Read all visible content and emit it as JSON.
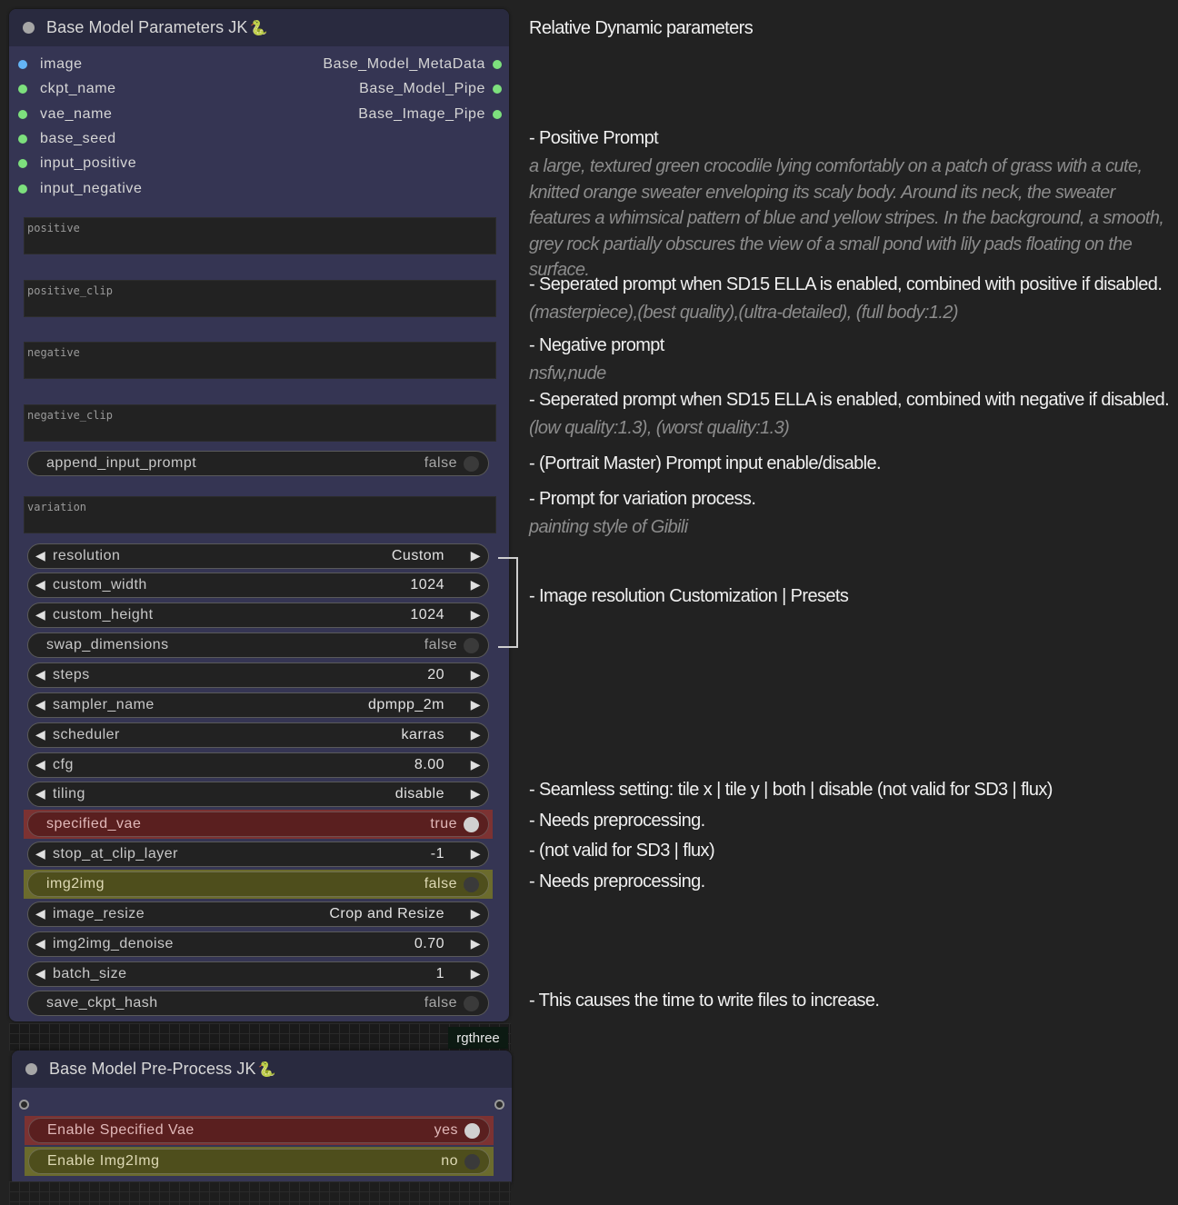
{
  "node_params": {
    "title": "Base Model Parameters JK",
    "title_icon": "🐍",
    "inputs": [
      "image",
      "ckpt_name",
      "vae_name",
      "base_seed",
      "input_positive",
      "input_negative"
    ],
    "outputs": [
      "Base_Model_MetaData",
      "Base_Model_Pipe",
      "Base_Image_Pipe"
    ],
    "textboxes": {
      "positive": "positive",
      "positive_clip": "positive_clip",
      "negative": "negative",
      "negative_clip": "negative_clip",
      "variation": "variation"
    },
    "append_input_prompt": {
      "label": "append_input_prompt",
      "value": "false"
    },
    "widgets": {
      "resolution": {
        "label": "resolution",
        "value": "Custom"
      },
      "custom_width": {
        "label": "custom_width",
        "value": "1024"
      },
      "custom_height": {
        "label": "custom_height",
        "value": "1024"
      },
      "swap_dimensions": {
        "label": "swap_dimensions",
        "value": "false"
      },
      "steps": {
        "label": "steps",
        "value": "20"
      },
      "sampler_name": {
        "label": "sampler_name",
        "value": "dpmpp_2m"
      },
      "scheduler": {
        "label": "scheduler",
        "value": "karras"
      },
      "cfg": {
        "label": "cfg",
        "value": "8.00"
      },
      "tiling": {
        "label": "tiling",
        "value": "disable"
      },
      "specified_vae": {
        "label": "specified_vae",
        "value": "true"
      },
      "stop_at_clip_layer": {
        "label": "stop_at_clip_layer",
        "value": "-1"
      },
      "img2img": {
        "label": "img2img",
        "value": "false"
      },
      "image_resize": {
        "label": "image_resize",
        "value": "Crop and Resize"
      },
      "img2img_denoise": {
        "label": "img2img_denoise",
        "value": "0.70"
      },
      "batch_size": {
        "label": "batch_size",
        "value": "1"
      },
      "save_ckpt_hash": {
        "label": "save_ckpt_hash",
        "value": "false"
      }
    }
  },
  "rgthree_label": "rgthree",
  "node_preprocess": {
    "title": "Base Model Pre-Process JK",
    "title_icon": "🐍",
    "enable_vae": {
      "label": "Enable Specified Vae",
      "value": "yes"
    },
    "enable_img2img": {
      "label": "Enable Img2Img",
      "value": "no"
    }
  },
  "notes": {
    "heading": "Relative Dynamic parameters",
    "positive_title": "- Positive Prompt",
    "positive_example": "a large, textured green crocodile lying comfortably on a patch of grass with a cute, knitted orange sweater enveloping its scaly body. Around its neck, the sweater features a whimsical pattern of blue and yellow stripes. In the background, a smooth, grey rock partially obscures the view of a small pond with lily pads floating on the surface.",
    "positive_clip_title": "- Seperated prompt when SD15 ELLA is enabled, combined with positive if disabled.",
    "positive_clip_example": "(masterpiece),(best quality),(ultra-detailed), (full body:1.2)",
    "negative_title": "- Negative prompt",
    "negative_example": "nsfw,nude",
    "negative_clip_title": "- Seperated prompt when SD15 ELLA is enabled, combined with negative if disabled.",
    "negative_clip_example": "(low quality:1.3), (worst quality:1.3)",
    "portrait_master": "- (Portrait Master) Prompt input enable/disable.",
    "variation_title": "- Prompt for variation process.",
    "variation_example": "painting style of Gibili",
    "resolution_note": "- Image resolution Customization | Presets",
    "tiling_note": "- Seamless setting: tile x | tile y | both | disable (not valid for SD3 | flux)",
    "vae_note": "- Needs preprocessing.",
    "clip_note": "- (not valid for SD3 | flux)",
    "img2img_note": "- Needs preprocessing.",
    "hash_note": "- This causes the time to write files to increase."
  },
  "colors": {
    "node_body": "#353553",
    "node_title": "#292a3f",
    "red_widget": "#7c3232",
    "yellow_widget": "#6b6b2d",
    "input_dot": "#7de07d",
    "image_dot": "#64b5f6"
  }
}
